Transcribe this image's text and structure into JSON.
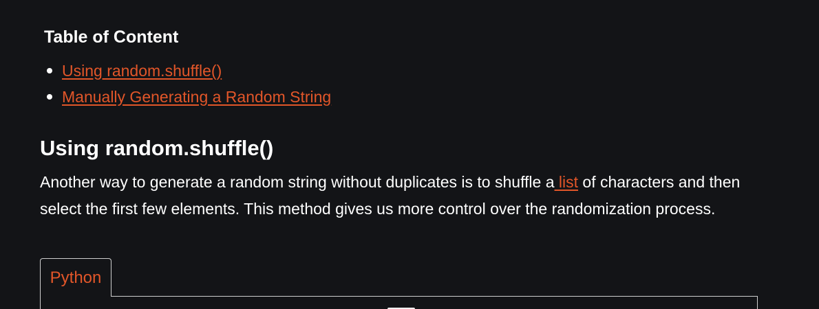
{
  "toc": {
    "title": "Table of Content",
    "items": [
      {
        "label": "Using random.shuffle()"
      },
      {
        "label": "Manually Generating a Random String"
      }
    ]
  },
  "section": {
    "heading": "Using random.shuffle()",
    "paragraph_before_link": "Another way to generate a random string without duplicates is to shuffle a",
    "link_text": " list",
    "paragraph_after_link": " of characters and then select the first few elements. This method gives us more control over the randomization process."
  },
  "code_tabs": {
    "active_tab": "Python"
  },
  "colors": {
    "background": "#131417",
    "text": "#ffffff",
    "link": "#e25629",
    "border": "#d0d0d0"
  }
}
